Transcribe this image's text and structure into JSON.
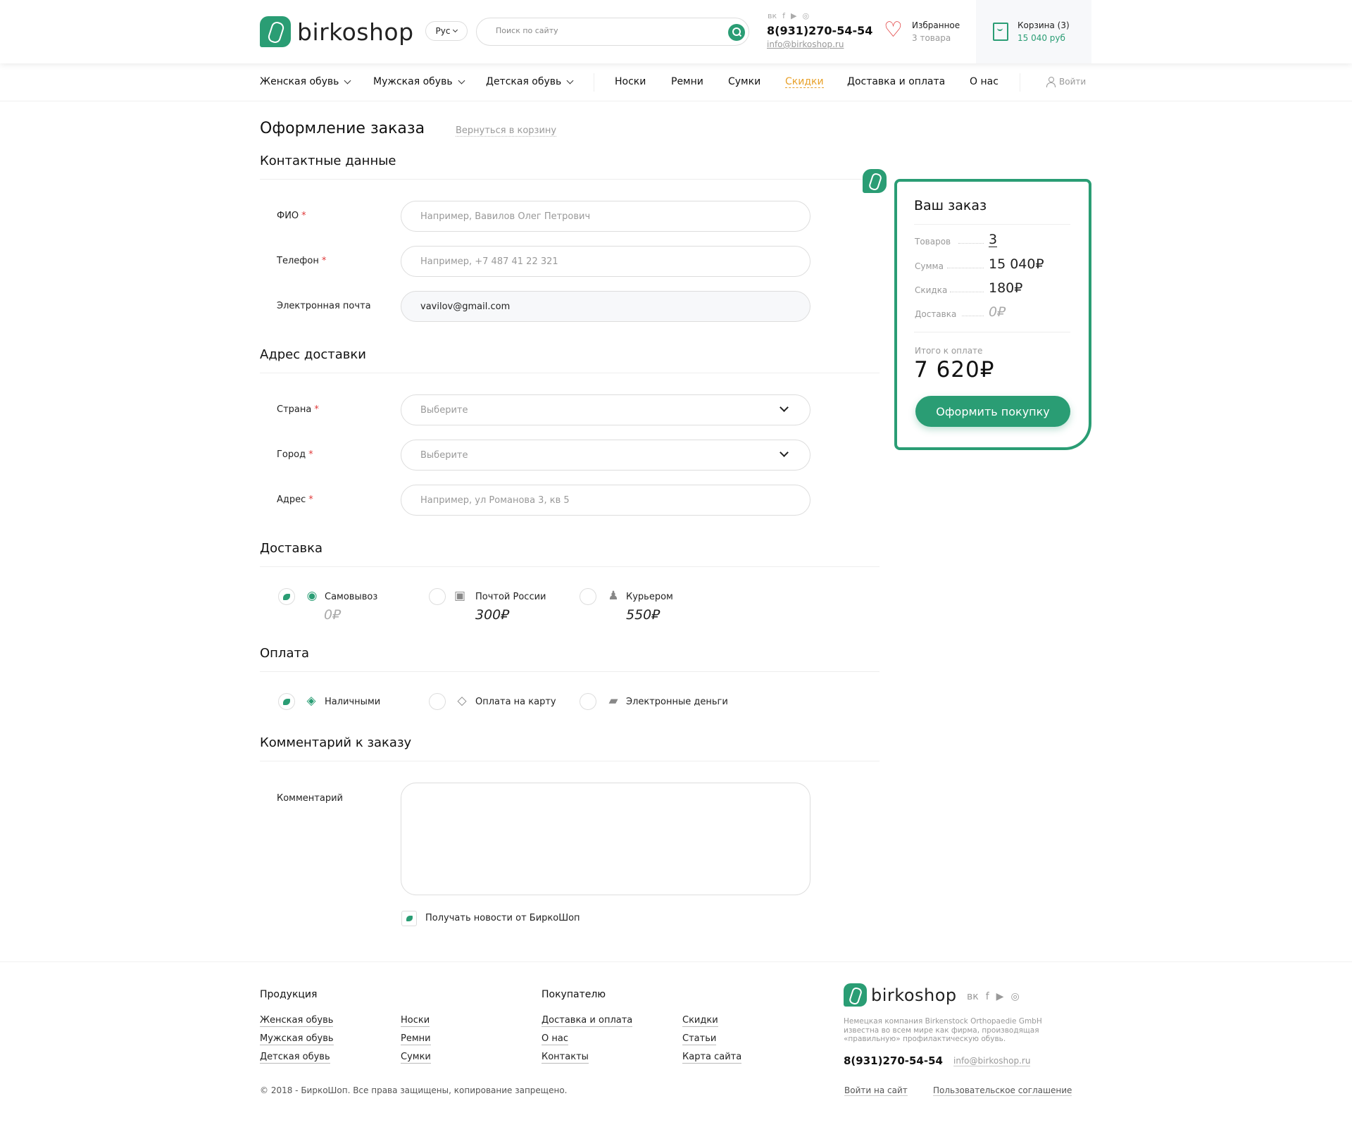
{
  "header": {
    "logo_text": "birkoshop",
    "lang": "Рус",
    "search_placeholder": "Поиск по сайту",
    "social_icons": [
      "vk-icon",
      "facebook-icon",
      "youtube-icon",
      "instagram-icon"
    ],
    "phone": "8(931)270-54-54",
    "email": "info@birkoshop.ru",
    "favorites_label": "Избранное",
    "favorites_count": "3 товара",
    "cart_label": "Корзина (3)",
    "cart_total": "15 040 руб"
  },
  "nav": {
    "items": [
      {
        "label": "Женская обувь",
        "dropdown": true
      },
      {
        "label": "Мужская обувь",
        "dropdown": true
      },
      {
        "label": "Детская обувь",
        "dropdown": true
      },
      {
        "label": "Носки"
      },
      {
        "label": "Ремни"
      },
      {
        "label": "Сумки"
      },
      {
        "label": "Скидки",
        "active": true
      },
      {
        "label": "Доставка и оплата"
      },
      {
        "label": "О нас"
      }
    ],
    "login": "Войти"
  },
  "page": {
    "title": "Оформление заказа",
    "back_link": "Вернуться в корзину"
  },
  "contacts": {
    "title": "Контактные данные",
    "name_label": "ФИО",
    "name_placeholder": "Например, Вавилов Олег Петрович",
    "phone_label": "Телефон",
    "phone_placeholder": "Например, +7 487 41 22 321",
    "email_label": "Электронная почта",
    "email_value": "vavilov@gmail.com",
    "required_mark": "*"
  },
  "address": {
    "title": "Адрес доставки",
    "country_label": "Страна",
    "country_value": "Выберите",
    "city_label": "Город",
    "city_value": "Выберите",
    "address_label": "Адрес",
    "address_placeholder": "Например, ул Романова 3, кв 5"
  },
  "delivery": {
    "title": "Доставка",
    "options": [
      {
        "label": "Самовывоз",
        "price": "0₽",
        "selected": true,
        "icon": "pickup-icon"
      },
      {
        "label": "Почтой России",
        "price": "300₽",
        "selected": false,
        "icon": "russian-post-icon"
      },
      {
        "label": "Курьером",
        "price": "550₽",
        "selected": false,
        "icon": "courier-icon"
      }
    ]
  },
  "payment": {
    "title": "Оплата",
    "options": [
      {
        "label": "Наличными",
        "selected": true,
        "icon": "cash-icon"
      },
      {
        "label": "Оплата на карту",
        "selected": false,
        "icon": "card-icon"
      },
      {
        "label": "Электронные деньги",
        "selected": false,
        "icon": "wallet-icon"
      }
    ]
  },
  "comment": {
    "title": "Комментарий к заказу",
    "label": "Комментарий",
    "newsletter_label": "Получать новости от БиркоШоп",
    "newsletter_checked": true
  },
  "order": {
    "title": "Ваш заказ",
    "items_label": "Товаров",
    "items_value": "3",
    "sum_label": "Сумма",
    "sum_value": "15 040₽",
    "discount_label": "Скидка",
    "discount_value": "180₽",
    "delivery_label": "Доставка",
    "delivery_value": "0₽",
    "total_label": "Итого к оплате",
    "total_value": "7 620₽",
    "buy_button": "Оформить покупку"
  },
  "footer": {
    "products_title": "Продукция",
    "products_links": [
      "Женская обувь",
      "Мужская обувь",
      "Детская обувь"
    ],
    "products_links2": [
      "Носки",
      "Ремни",
      "Сумки"
    ],
    "buyer_title": "Покупателю",
    "buyer_links": [
      "Доставка и оплата",
      "О нас",
      "Контакты"
    ],
    "buyer_links2": [
      "Скидки",
      "Статьи",
      "Карта сайта"
    ],
    "logo_text": "birkoshop",
    "description": "Немецкая компания Birkenstock Orthopaedie GmbH известна во всем мире как фирма, производящая «правильную» профилактическую обувь.",
    "phone": "8(931)270-54-54",
    "email": "info@birkoshop.ru",
    "copyright": "© 2018 - БиркоШоп. Все права защищены, копирование запрещено.",
    "login_link": "Войти на сайт",
    "agreement_link": "Пользовательское соглашение"
  },
  "colors": {
    "accent": "#2a9d74",
    "active_nav": "#e8a12a",
    "required": "#e03a3a"
  }
}
